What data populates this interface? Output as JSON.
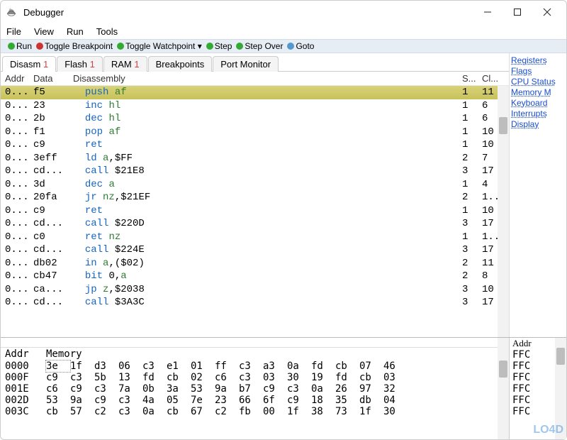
{
  "window": {
    "title": "Debugger"
  },
  "menubar": [
    "File",
    "View",
    "Run",
    "Tools"
  ],
  "toolbar": [
    "Run",
    "Toggle Breakpoint",
    "Toggle Watchpoint ▾",
    "Step",
    "Step Over",
    "Goto"
  ],
  "tabs": [
    {
      "label": "Disasm",
      "num": "1",
      "active": true
    },
    {
      "label": "Flash",
      "num": "1"
    },
    {
      "label": "RAM",
      "num": "1"
    },
    {
      "label": "Breakpoints"
    },
    {
      "label": "Port Monitor"
    }
  ],
  "disasm": {
    "headers": {
      "addr": "Addr",
      "data": "Data",
      "dis": "Disassembly",
      "s": "S...",
      "c": "Cl..."
    },
    "rows": [
      {
        "addr": "0...",
        "data": "f5",
        "op": "push",
        "arg": "af",
        "argcls": "reg",
        "s": "1",
        "c": "11",
        "hl": true
      },
      {
        "addr": "0...",
        "data": "23",
        "op": "inc",
        "arg": "hl",
        "argcls": "reg",
        "s": "1",
        "c": "6"
      },
      {
        "addr": "0...",
        "data": "2b",
        "op": "dec",
        "arg": "hl",
        "argcls": "reg",
        "s": "1",
        "c": "6"
      },
      {
        "addr": "0...",
        "data": "f1",
        "op": "pop",
        "arg": "af",
        "argcls": "reg",
        "s": "1",
        "c": "10"
      },
      {
        "addr": "0...",
        "data": "c9",
        "op": "ret",
        "arg": "",
        "s": "1",
        "c": "10"
      },
      {
        "addr": "0...",
        "data": "3eff",
        "op": "ld",
        "arg": "a",
        "argcls": "reg",
        "tail": ",$FF",
        "s": "2",
        "c": "7"
      },
      {
        "addr": "0...",
        "data": "cd...",
        "op": "call",
        "arg": "$21E8",
        "s": "3",
        "c": "17"
      },
      {
        "addr": "0...",
        "data": "3d",
        "op": "dec",
        "arg": "a",
        "argcls": "reg",
        "s": "1",
        "c": "4"
      },
      {
        "addr": "0...",
        "data": "20fa",
        "op": "jr",
        "arg": "nz",
        "argcls": "cond",
        "tail": ",$21EF",
        "s": "2",
        "c": "1..."
      },
      {
        "addr": "0...",
        "data": "c9",
        "op": "ret",
        "arg": "",
        "s": "1",
        "c": "10"
      },
      {
        "addr": "0...",
        "data": "cd...",
        "op": "call",
        "arg": "$220D",
        "s": "3",
        "c": "17"
      },
      {
        "addr": "0...",
        "data": "c0",
        "op": "ret",
        "arg": "nz",
        "argcls": "cond",
        "s": "1",
        "c": "1..."
      },
      {
        "addr": "0...",
        "data": "cd...",
        "op": "call",
        "arg": "$224E",
        "s": "3",
        "c": "17"
      },
      {
        "addr": "0...",
        "data": "db02",
        "op": "in",
        "arg": "a",
        "argcls": "reg",
        "tail": ",($02)",
        "s": "2",
        "c": "11"
      },
      {
        "addr": "0...",
        "data": "cb47",
        "op": "bit",
        "arg": "0,",
        "tail2": "a",
        "tail2cls": "reg",
        "s": "2",
        "c": "8"
      },
      {
        "addr": "0...",
        "data": "ca...",
        "op": "jp",
        "arg": "z",
        "argcls": "cond",
        "tail": ",$2038",
        "s": "3",
        "c": "10"
      },
      {
        "addr": "0...",
        "data": "cd...",
        "op": "call",
        "arg": "$3A3C",
        "s": "3",
        "c": "17"
      }
    ]
  },
  "sidelinks": [
    "Registers",
    "Flags",
    "CPU Status",
    "Memory M",
    "Keyboard",
    "Interrupts",
    "Display"
  ],
  "memory": {
    "headers": {
      "addr": "Addr",
      "mem": "Memory"
    },
    "rows": [
      {
        "addr": "0000",
        "bytes": [
          "3e",
          "1f",
          "d3",
          "06",
          "c3",
          "e1",
          "01",
          "ff",
          "c3",
          "a3",
          "0a",
          "fd",
          "cb",
          "07",
          "46"
        ],
        "sel": 0
      },
      {
        "addr": "000F",
        "bytes": [
          "c9",
          "c3",
          "5b",
          "13",
          "fd",
          "cb",
          "02",
          "c6",
          "c3",
          "03",
          "30",
          "19",
          "fd",
          "cb",
          "03"
        ]
      },
      {
        "addr": "001E",
        "bytes": [
          "c6",
          "c9",
          "c3",
          "7a",
          "0b",
          "3a",
          "53",
          "9a",
          "b7",
          "c9",
          "c3",
          "0a",
          "26",
          "97",
          "32"
        ]
      },
      {
        "addr": "002D",
        "bytes": [
          "53",
          "9a",
          "c9",
          "c3",
          "4a",
          "05",
          "7e",
          "23",
          "66",
          "6f",
          "c9",
          "18",
          "35",
          "db",
          "04"
        ]
      },
      {
        "addr": "003C",
        "bytes": [
          "cb",
          "57",
          "c2",
          "c3",
          "0a",
          "cb",
          "67",
          "c2",
          "fb",
          "00",
          "1f",
          "38",
          "73",
          "1f",
          "30"
        ]
      }
    ]
  },
  "stack": {
    "header": "Addr",
    "rows": [
      "FFC",
      "FFC",
      "FFC",
      "FFC",
      "FFC",
      "FFC"
    ]
  },
  "watermark": "LO4D"
}
